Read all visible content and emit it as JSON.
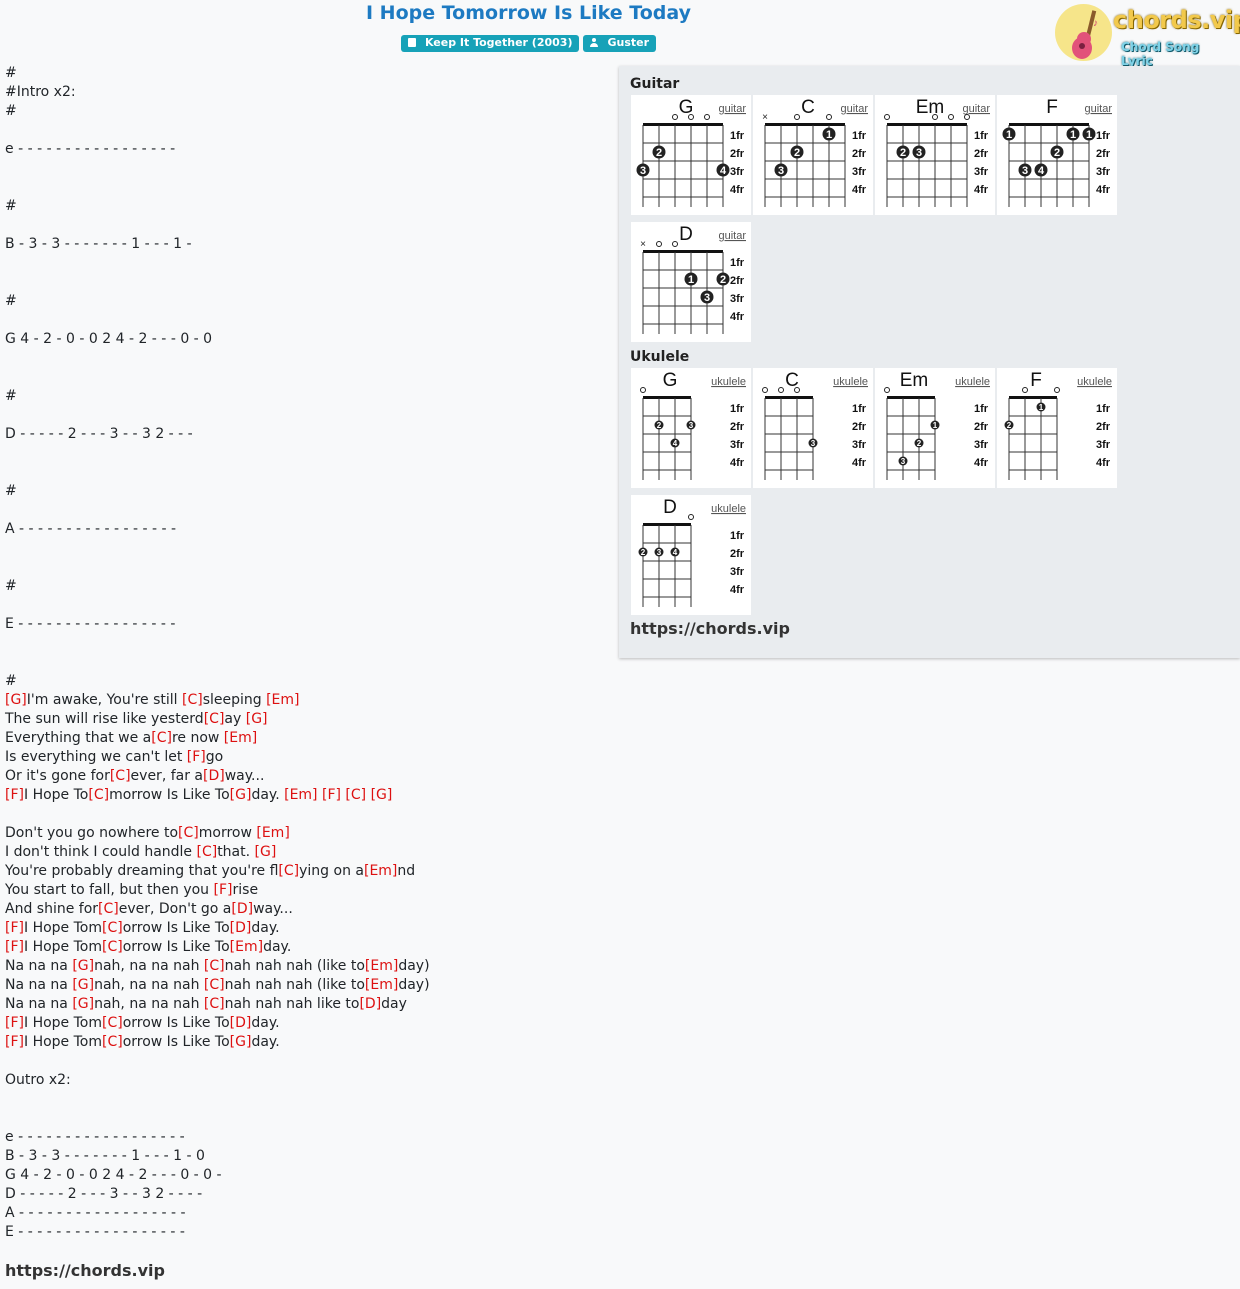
{
  "page": {
    "title": "I Hope Tomorrow Is Like Today",
    "album_badge": "Keep It Together (2003)",
    "artist_badge": "Guster",
    "icons": {
      "album": "book-icon",
      "artist": "user-icon"
    }
  },
  "logo": {
    "brand": "chords.vip",
    "tagline": "Chord Song Lyric",
    "icon": "guitar-logo-icon"
  },
  "sheet": {
    "lines": [
      [
        {
          "t": "#"
        }
      ],
      [
        {
          "t": "#Intro x2:"
        }
      ],
      [
        {
          "t": "#"
        }
      ],
      [],
      [
        {
          "t": "e - - - - - - - - - - - - - - - - -"
        }
      ],
      [],
      [],
      [
        {
          "t": "#"
        }
      ],
      [],
      [
        {
          "t": "B - 3 - 3 - - - - - - - 1 - - - 1 - "
        }
      ],
      [],
      [],
      [
        {
          "t": "#"
        }
      ],
      [],
      [
        {
          "t": "G 4 - 2 - 0 - 0 2 4 - 2 - - - 0 - 0"
        }
      ],
      [],
      [],
      [
        {
          "t": "#"
        }
      ],
      [],
      [
        {
          "t": "D - - - - - 2 - - - 3 - - 3 2 - - -"
        }
      ],
      [],
      [],
      [
        {
          "t": "#"
        }
      ],
      [],
      [
        {
          "t": "A - - - - - - - - - - - - - - - - -"
        }
      ],
      [],
      [],
      [
        {
          "t": "#"
        }
      ],
      [],
      [
        {
          "t": "E - - - - - - - - - - - - - - - - -"
        }
      ],
      [],
      [],
      [
        {
          "t": "#"
        }
      ],
      [
        {
          "c": "[G]"
        },
        {
          "t": "I'm awake, You're still "
        },
        {
          "c": "[C]"
        },
        {
          "t": "sleeping "
        },
        {
          "c": "[Em]"
        }
      ],
      [
        {
          "t": "The sun will rise like yesterd"
        },
        {
          "c": "[C]"
        },
        {
          "t": "ay "
        },
        {
          "c": "[G]"
        }
      ],
      [
        {
          "t": "Everything that we a"
        },
        {
          "c": "[C]"
        },
        {
          "t": "re now "
        },
        {
          "c": "[Em]"
        }
      ],
      [
        {
          "t": "Is everything we can't let "
        },
        {
          "c": "[F]"
        },
        {
          "t": "go"
        }
      ],
      [
        {
          "t": "Or it's gone for"
        },
        {
          "c": "[C]"
        },
        {
          "t": "ever, far a"
        },
        {
          "c": "[D]"
        },
        {
          "t": "way..."
        }
      ],
      [
        {
          "c": "[F]"
        },
        {
          "t": "I Hope To"
        },
        {
          "c": "[C]"
        },
        {
          "t": "morrow Is Like To"
        },
        {
          "c": "[G]"
        },
        {
          "t": "day. "
        },
        {
          "c": "[Em]"
        },
        {
          "t": " "
        },
        {
          "c": "[F]"
        },
        {
          "t": " "
        },
        {
          "c": "[C]"
        },
        {
          "t": " "
        },
        {
          "c": "[G]"
        }
      ],
      [],
      [
        {
          "t": "Don't you go nowhere to"
        },
        {
          "c": "[C]"
        },
        {
          "t": "morrow "
        },
        {
          "c": "[Em]"
        }
      ],
      [
        {
          "t": "I don't think I could handle "
        },
        {
          "c": "[C]"
        },
        {
          "t": "that. "
        },
        {
          "c": "[G]"
        }
      ],
      [
        {
          "t": "You're probably dreaming that you're fl"
        },
        {
          "c": "[C]"
        },
        {
          "t": "ying on a"
        },
        {
          "c": "[Em]"
        },
        {
          "t": "nd"
        }
      ],
      [
        {
          "t": "You start to fall, but then you "
        },
        {
          "c": "[F]"
        },
        {
          "t": "rise"
        }
      ],
      [
        {
          "t": "And shine for"
        },
        {
          "c": "[C]"
        },
        {
          "t": "ever, Don't go a"
        },
        {
          "c": "[D]"
        },
        {
          "t": "way..."
        }
      ],
      [
        {
          "c": "[F]"
        },
        {
          "t": "I Hope Tom"
        },
        {
          "c": "[C]"
        },
        {
          "t": "orrow Is Like To"
        },
        {
          "c": "[D]"
        },
        {
          "t": "day."
        }
      ],
      [
        {
          "c": "[F]"
        },
        {
          "t": "I Hope Tom"
        },
        {
          "c": "[C]"
        },
        {
          "t": "orrow Is Like To"
        },
        {
          "c": "[Em]"
        },
        {
          "t": "day."
        }
      ],
      [
        {
          "t": "Na na na "
        },
        {
          "c": "[G]"
        },
        {
          "t": "nah, na na nah "
        },
        {
          "c": "[C]"
        },
        {
          "t": "nah nah nah (like to"
        },
        {
          "c": "[Em]"
        },
        {
          "t": "day)"
        }
      ],
      [
        {
          "t": "Na na na "
        },
        {
          "c": "[G]"
        },
        {
          "t": "nah, na na nah "
        },
        {
          "c": "[C]"
        },
        {
          "t": "nah nah nah (like to"
        },
        {
          "c": "[Em]"
        },
        {
          "t": "day)"
        }
      ],
      [
        {
          "t": "Na na na "
        },
        {
          "c": "[G]"
        },
        {
          "t": "nah, na na nah "
        },
        {
          "c": "[C]"
        },
        {
          "t": "nah nah nah like to"
        },
        {
          "c": "[D]"
        },
        {
          "t": "day"
        }
      ],
      [
        {
          "c": "[F]"
        },
        {
          "t": "I Hope Tom"
        },
        {
          "c": "[C]"
        },
        {
          "t": "orrow Is Like To"
        },
        {
          "c": "[D]"
        },
        {
          "t": "day."
        }
      ],
      [
        {
          "c": "[F]"
        },
        {
          "t": "I Hope Tom"
        },
        {
          "c": "[C]"
        },
        {
          "t": "orrow Is Like To"
        },
        {
          "c": "[G]"
        },
        {
          "t": "day."
        }
      ],
      [],
      [
        {
          "t": "Outro x2:"
        }
      ],
      [],
      [],
      [
        {
          "t": "e - - - - - - - - - - - - - - - - - -"
        }
      ],
      [
        {
          "t": "B - 3 - 3 - - - - - - - 1 - - - 1 - 0"
        }
      ],
      [
        {
          "t": "G 4 - 2 - 0 - 0 2 4 - 2 - - - 0 - 0 -"
        }
      ],
      [
        {
          "t": "D - - - - - 2 - - - 3 - - 3 2 - - - -"
        }
      ],
      [
        {
          "t": "A - - - - - - - - - - - - - - - - - -"
        }
      ],
      [
        {
          "t": "E - - - - - - - - - - - - - - - - - -"
        }
      ]
    ],
    "footer": "https://chords.vip"
  },
  "panel": {
    "guitar_title": "Guitar",
    "ukulele_title": "Ukulele",
    "footer": "https://chords.vip",
    "fret_labels": [
      "1fr",
      "2fr",
      "3fr",
      "4fr"
    ],
    "guitar": [
      {
        "name": "G",
        "link": "guitar",
        "open": [
          2,
          3,
          4
        ],
        "mute": [],
        "dots": [
          {
            "s": 1,
            "f": 2,
            "n": "2"
          },
          {
            "s": 0,
            "f": 3,
            "n": "3"
          },
          {
            "s": 5,
            "f": 3,
            "n": "4"
          }
        ]
      },
      {
        "name": "C",
        "link": "guitar",
        "open": [
          2,
          4
        ],
        "mute": [
          0
        ],
        "dots": [
          {
            "s": 4,
            "f": 1,
            "n": "1"
          },
          {
            "s": 2,
            "f": 2,
            "n": "2"
          },
          {
            "s": 1,
            "f": 3,
            "n": "3"
          }
        ]
      },
      {
        "name": "Em",
        "link": "guitar",
        "open": [
          0,
          3,
          4,
          5
        ],
        "mute": [],
        "dots": [
          {
            "s": 1,
            "f": 2,
            "n": "2"
          },
          {
            "s": 2,
            "f": 2,
            "n": "3"
          }
        ]
      },
      {
        "name": "F",
        "link": "guitar",
        "open": [],
        "mute": [],
        "dots": [
          {
            "s": 0,
            "f": 1,
            "n": "1"
          },
          {
            "s": 4,
            "f": 1,
            "n": "1"
          },
          {
            "s": 5,
            "f": 1,
            "n": "1"
          },
          {
            "s": 3,
            "f": 2,
            "n": "2"
          },
          {
            "s": 1,
            "f": 3,
            "n": "3"
          },
          {
            "s": 2,
            "f": 3,
            "n": "4"
          }
        ]
      },
      {
        "name": "D",
        "link": "guitar",
        "open": [
          1,
          2
        ],
        "mute": [
          0
        ],
        "dots": [
          {
            "s": 3,
            "f": 2,
            "n": "1"
          },
          {
            "s": 5,
            "f": 2,
            "n": "2"
          },
          {
            "s": 4,
            "f": 3,
            "n": "3"
          }
        ]
      }
    ],
    "ukulele": [
      {
        "name": "G",
        "link": "ukulele",
        "open": [
          0
        ],
        "mute": [],
        "dots": [
          {
            "s": 1,
            "f": 2,
            "n": "2"
          },
          {
            "s": 3,
            "f": 2,
            "n": "3"
          },
          {
            "s": 2,
            "f": 3,
            "n": "4"
          }
        ]
      },
      {
        "name": "C",
        "link": "ukulele",
        "open": [
          0,
          1,
          2
        ],
        "mute": [],
        "dots": [
          {
            "s": 3,
            "f": 3,
            "n": "3"
          }
        ]
      },
      {
        "name": "Em",
        "link": "ukulele",
        "open": [
          0
        ],
        "mute": [],
        "dots": [
          {
            "s": 3,
            "f": 2,
            "n": "1"
          },
          {
            "s": 2,
            "f": 3,
            "n": "2"
          },
          {
            "s": 1,
            "f": 4,
            "n": "3"
          }
        ]
      },
      {
        "name": "F",
        "link": "ukulele",
        "open": [
          1,
          3
        ],
        "mute": [],
        "dots": [
          {
            "s": 2,
            "f": 1,
            "n": "1"
          },
          {
            "s": 0,
            "f": 2,
            "n": "2"
          }
        ]
      },
      {
        "name": "D",
        "link": "ukulele",
        "open": [
          3
        ],
        "mute": [],
        "dots": [
          {
            "s": 0,
            "f": 2,
            "n": "2"
          },
          {
            "s": 1,
            "f": 2,
            "n": "3"
          },
          {
            "s": 2,
            "f": 2,
            "n": "4"
          }
        ]
      }
    ]
  },
  "colors": {
    "title": "#1d7ac2",
    "badge": "#17a2b8",
    "chord": "#dd1111",
    "panel_bg": "#e9ecef"
  }
}
